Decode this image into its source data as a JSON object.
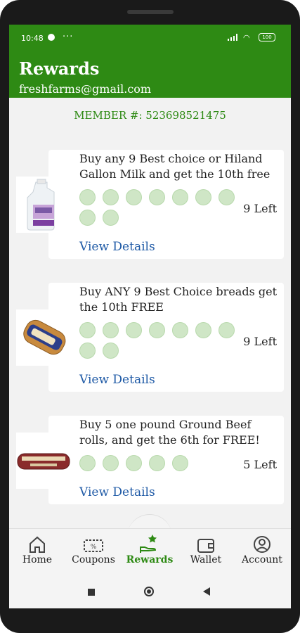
{
  "status": {
    "time": "10:48",
    "battery": "100"
  },
  "header": {
    "title": "Rewards",
    "email": "freshfarms@gmail.com"
  },
  "member": {
    "text": "MEMBER #: 523698521475"
  },
  "rewards": [
    {
      "text": "Buy any 9 Best choice or Hiland Gallon Milk and get the 10th free",
      "remaining": "9 Left",
      "total_stamps": 9,
      "filled_stamps": 0,
      "link": "View Details",
      "product_icon": "milk-gallon"
    },
    {
      "text": "Buy ANY 9 Best Choice breads get the 10th FREE",
      "remaining": "9 Left",
      "total_stamps": 9,
      "filled_stamps": 0,
      "link": "View Details",
      "product_icon": "bread-loaf"
    },
    {
      "text": "Buy 5 one pound Ground Beef rolls, and get the 6th for FREE!",
      "remaining": "5 Left",
      "total_stamps": 5,
      "filled_stamps": 0,
      "link": "View Details",
      "product_icon": "ground-beef-roll"
    }
  ],
  "nav": {
    "home": "Home",
    "coupons": "Coupons",
    "rewards": "Rewards",
    "wallet": "Wallet",
    "account": "Account"
  },
  "colors": {
    "brand": "#2e8a14",
    "link": "#1f5aa6",
    "stamp": "#cfe6c6"
  }
}
